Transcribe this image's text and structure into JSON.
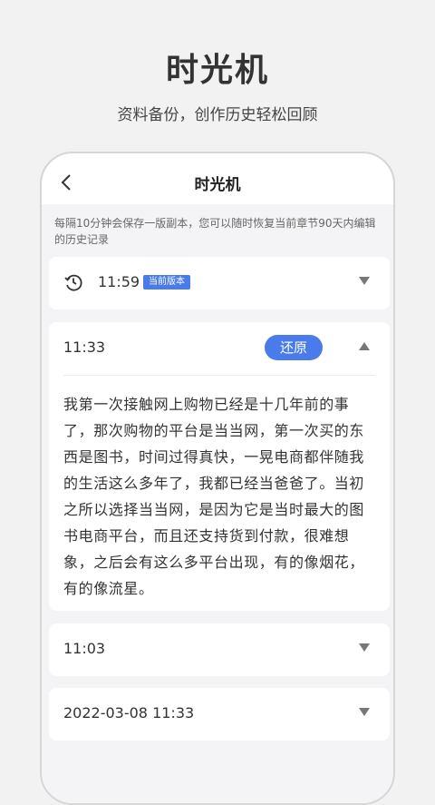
{
  "promo": {
    "title": "时光机",
    "subtitle": "资料备份，创作历史轻松回顾"
  },
  "app": {
    "title": "时光机",
    "back_icon": "chevron-left-icon",
    "notice": "每隔10分钟会保存一版副本，您可以随时恢复当前章节90天内编辑的历史记录"
  },
  "versions": [
    {
      "time": "11:59",
      "badge": "当前版本",
      "icon": "history-icon",
      "expanded": false
    },
    {
      "time": "11:33",
      "action": "还原",
      "expanded": true,
      "content": "我第一次接触网上购物已经是十几年前的事了，那次购物的平台是当当网，第一次买的东西是图书，时间过得真快，一晃电商都伴随我的生活这么多年了，我都已经当爸爸了。当初之所以选择当当网，是因为它是当时最大的图书电商平台，而且还支持货到付款，很难想象，之后会有这么多平台出现，有的像烟花，有的像流星。"
    },
    {
      "time": "11:03",
      "expanded": false
    },
    {
      "time": "2022-03-08 11:33",
      "expanded": false
    }
  ],
  "colors": {
    "accent": "#4a7bea",
    "background": "#f4f4f6"
  }
}
